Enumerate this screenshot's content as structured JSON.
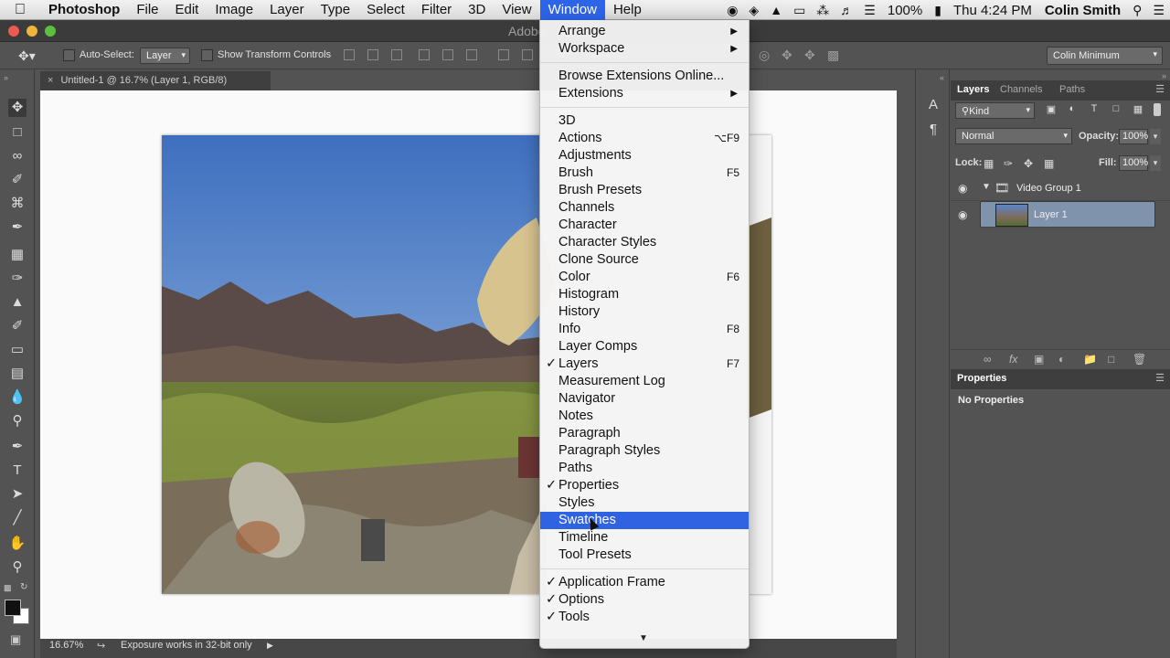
{
  "menubar": {
    "app": "Photoshop",
    "menus": [
      "File",
      "Edit",
      "Image",
      "Layer",
      "Type",
      "Select",
      "Filter",
      "3D",
      "View",
      "Window",
      "Help"
    ],
    "active_menu": "Window",
    "battery": "100%",
    "clock": "Thu 4:24 PM",
    "user": "Colin Smith"
  },
  "window": {
    "title": "Adobe"
  },
  "options": {
    "auto_select_label": "Auto-Select:",
    "auto_select_value": "Layer",
    "transform_label": "Show Transform Controls",
    "workspace": "Colin Minimum"
  },
  "document": {
    "tab_title": "Untitled-1 @ 16.7% (Layer 1, RGB/8)",
    "zoom": "16.67%",
    "status": "Exposure works in 32-bit only"
  },
  "layers_panel": {
    "tabs": [
      "Layers",
      "Channels",
      "Paths"
    ],
    "filter": "Kind",
    "blend_mode": "Normal",
    "opacity_label": "Opacity:",
    "opacity": "100%",
    "lock_label": "Lock:",
    "fill_label": "Fill:",
    "fill": "100%",
    "group_name": "Video Group 1",
    "layer_name": "Layer 1"
  },
  "properties_panel": {
    "title": "Properties",
    "empty_text": "No Properties"
  },
  "window_menu": {
    "items": [
      {
        "label": "Arrange",
        "submenu": true
      },
      {
        "label": "Workspace",
        "submenu": true
      },
      {
        "sep": true
      },
      {
        "label": "Browse Extensions Online..."
      },
      {
        "label": "Extensions",
        "submenu": true
      },
      {
        "sep": true
      },
      {
        "label": "3D"
      },
      {
        "label": "Actions",
        "shortcut": "⌥F9"
      },
      {
        "label": "Adjustments"
      },
      {
        "label": "Brush",
        "shortcut": "F5"
      },
      {
        "label": "Brush Presets"
      },
      {
        "label": "Channels"
      },
      {
        "label": "Character"
      },
      {
        "label": "Character Styles"
      },
      {
        "label": "Clone Source"
      },
      {
        "label": "Color",
        "shortcut": "F6"
      },
      {
        "label": "Histogram"
      },
      {
        "label": "History"
      },
      {
        "label": "Info",
        "shortcut": "F8"
      },
      {
        "label": "Layer Comps"
      },
      {
        "label": "Layers",
        "shortcut": "F7",
        "checked": true
      },
      {
        "label": "Measurement Log"
      },
      {
        "label": "Navigator"
      },
      {
        "label": "Notes"
      },
      {
        "label": "Paragraph"
      },
      {
        "label": "Paragraph Styles"
      },
      {
        "label": "Paths"
      },
      {
        "label": "Properties",
        "checked": true
      },
      {
        "label": "Styles"
      },
      {
        "label": "Swatches",
        "highlighted": true
      },
      {
        "label": "Timeline"
      },
      {
        "label": "Tool Presets"
      },
      {
        "sep": true
      },
      {
        "label": "Application Frame",
        "checked": true
      },
      {
        "label": "Options",
        "checked": true
      },
      {
        "label": "Tools",
        "checked": true
      }
    ]
  },
  "colors": {
    "menu_highlight": "#2f63e2",
    "layer_selected": "#7f93ad",
    "chrome": "#535353"
  }
}
